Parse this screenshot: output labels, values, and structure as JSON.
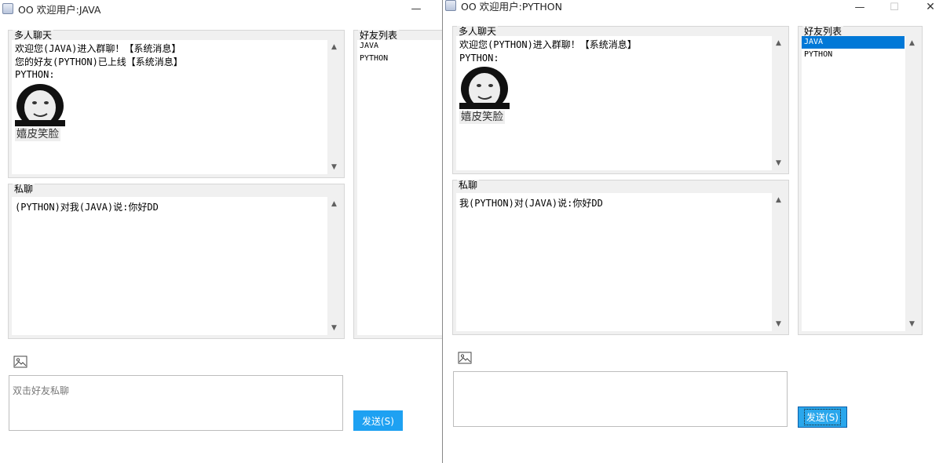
{
  "window_java": {
    "title": "OO  欢迎用户:JAVA",
    "minimize_glyph": "—",
    "group_chat": {
      "title": "多人聊天",
      "lines": [
        "欢迎您(JAVA)进入群聊！【系统消息】",
        "您的好友(PYTHON)已上线【系统消息】",
        "PYTHON:"
      ],
      "emoji_caption": "嬉皮笑脸"
    },
    "private_chat": {
      "title": "私聊",
      "lines": [
        "(PYTHON)对我(JAVA)说:你好DD"
      ]
    },
    "friend_list": {
      "title": "好友列表",
      "items": [
        "JAVA",
        "PYTHON"
      ]
    },
    "input": {
      "placeholder": "双击好友私聊"
    },
    "send_label": "发送(S)"
  },
  "window_python": {
    "title": "OO  欢迎用户:PYTHON",
    "minimize_glyph": "—",
    "maximize_glyph": "☐",
    "close_glyph": "✕",
    "group_chat": {
      "title": "多人聊天",
      "lines": [
        "欢迎您(PYTHON)进入群聊！【系统消息】",
        "PYTHON:"
      ],
      "emoji_caption": "嬉皮笑脸"
    },
    "private_chat": {
      "title": "私聊",
      "lines": [
        "我(PYTHON)对(JAVA)说:你好DD"
      ]
    },
    "friend_list": {
      "title": "好友列表",
      "items": [
        "JAVA",
        "PYTHON"
      ],
      "selected_index": 0
    },
    "input": {
      "placeholder": ""
    },
    "send_label": "发送(S)"
  },
  "colors": {
    "selection": "#0078d7",
    "send_button": "#1ea1f2",
    "panel": "#f0f0f0"
  },
  "icons": [
    "java-app-icon",
    "image-icon",
    "scroll-up-icon",
    "scroll-down-icon"
  ]
}
